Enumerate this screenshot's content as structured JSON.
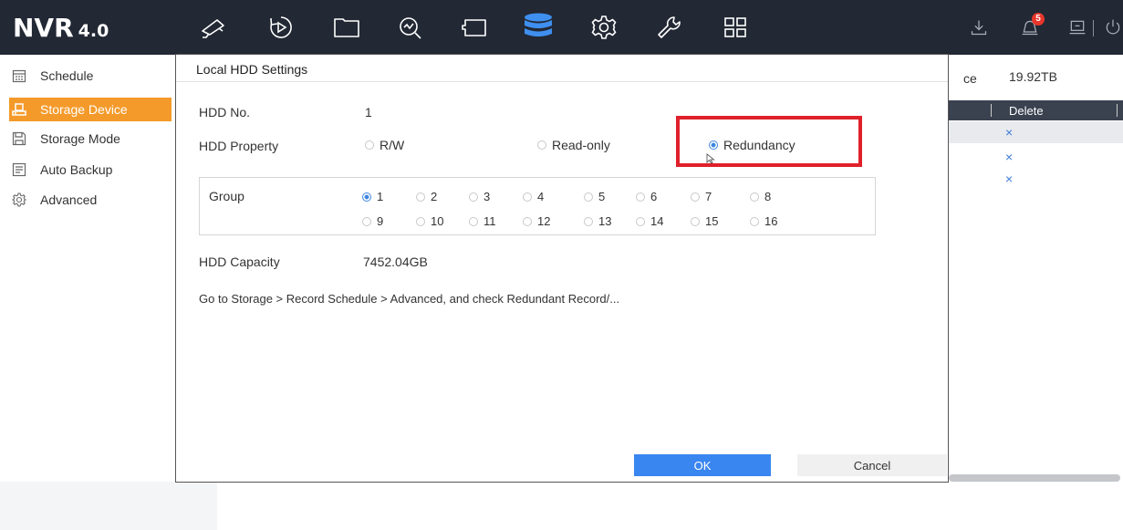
{
  "app": {
    "logo": "NVR",
    "version": "4.0"
  },
  "topbar": {
    "notification_count": "5",
    "icons": [
      "live-view-icon",
      "playback-icon",
      "file-icon",
      "search-icon",
      "picture-icon",
      "storage-icon",
      "settings-icon",
      "maintenance-icon",
      "menu-grid-icon"
    ]
  },
  "sidebar": {
    "items": [
      {
        "label": "Schedule",
        "icon": "schedule-icon"
      },
      {
        "label": "Storage Device",
        "icon": "storage-device-icon",
        "active": true
      },
      {
        "label": "Storage Mode",
        "icon": "storage-mode-icon"
      },
      {
        "label": "Auto Backup",
        "icon": "auto-backup-icon"
      },
      {
        "label": "Advanced",
        "icon": "advanced-icon"
      }
    ]
  },
  "background": {
    "free_space_label_partial": "ce",
    "free_space_value": "19.92TB",
    "column_delete": "Delete",
    "delete_symbol": "×"
  },
  "dialog": {
    "title": "Local HDD Settings",
    "hdd_no_label": "HDD No.",
    "hdd_no_value": "1",
    "hdd_property_label": "HDD Property",
    "property_options": [
      {
        "label": "R/W",
        "checked": false
      },
      {
        "label": "Read-only",
        "checked": false
      },
      {
        "label": "Redundancy",
        "checked": true
      }
    ],
    "group_label": "Group",
    "group_options": [
      "1",
      "2",
      "3",
      "4",
      "5",
      "6",
      "7",
      "8",
      "9",
      "10",
      "11",
      "12",
      "13",
      "14",
      "15",
      "16"
    ],
    "group_selected": "1",
    "hdd_capacity_label": "HDD Capacity",
    "hdd_capacity_value": "7452.04GB",
    "hint": "Go to Storage > Record Schedule > Advanced, and check Redundant Record/...",
    "ok_label": "OK",
    "cancel_label": "Cancel"
  },
  "colors": {
    "topbar": "#222834",
    "accent_orange": "#f49a2a",
    "primary_blue": "#3a86f0",
    "highlight_red": "#e0202a"
  }
}
